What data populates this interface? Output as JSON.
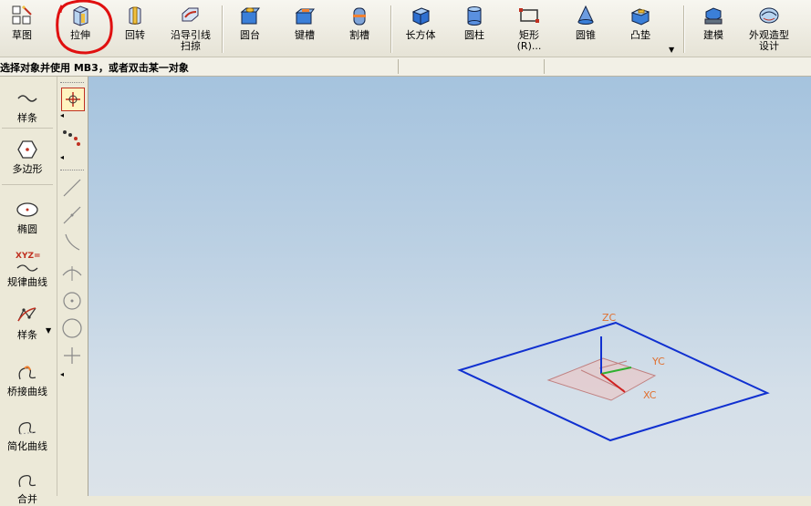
{
  "toolbar": {
    "items": [
      {
        "label": "草图",
        "icon": "sketch-icon"
      },
      {
        "label": "拉伸",
        "icon": "extrude-icon"
      },
      {
        "label": "回转",
        "icon": "revolve-icon"
      },
      {
        "label": "沿导引线\n扫掠",
        "icon": "sweep-along-guide-icon"
      },
      {
        "label": "圆台",
        "icon": "boss-icon"
      },
      {
        "label": "键槽",
        "icon": "slot-icon"
      },
      {
        "label": "割槽",
        "icon": "groove-icon"
      },
      {
        "label": "长方体",
        "icon": "block-icon"
      },
      {
        "label": "圆柱",
        "icon": "cylinder-icon"
      },
      {
        "label": "矩形\n(R)...",
        "icon": "rectangle-icon"
      },
      {
        "label": "圆锥",
        "icon": "cone-icon"
      },
      {
        "label": "凸垫",
        "icon": "pad-icon"
      },
      {
        "label": "建模",
        "icon": "modeling-icon"
      },
      {
        "label": "外观造型\n设计",
        "icon": "shape-studio-icon"
      }
    ]
  },
  "status": {
    "message": "选择对象并使用 MB3，或者双击某一对象"
  },
  "left_panel": {
    "items": [
      {
        "label": "样条",
        "icon": "spline-icon"
      },
      {
        "label": "多边形",
        "icon": "polygon-icon"
      },
      {
        "label": "椭圆",
        "icon": "ellipse-icon"
      },
      {
        "label": "规律曲线",
        "icon": "law-curve-icon",
        "icon_text": "XYZ="
      },
      {
        "label": "样条",
        "icon": "spline-edit-icon"
      },
      {
        "label": "桥接曲线",
        "icon": "bridge-curve-icon"
      },
      {
        "label": "简化曲线",
        "icon": "simplify-curve-icon"
      },
      {
        "label": "合并",
        "icon": "join-curve-icon"
      }
    ]
  },
  "viewport": {
    "axes": {
      "z": "ZC",
      "y": "YC",
      "x": "XC"
    }
  },
  "colors": {
    "annotation": "#E01010",
    "plane": "#1030D0",
    "axis_label": "#E07030"
  }
}
